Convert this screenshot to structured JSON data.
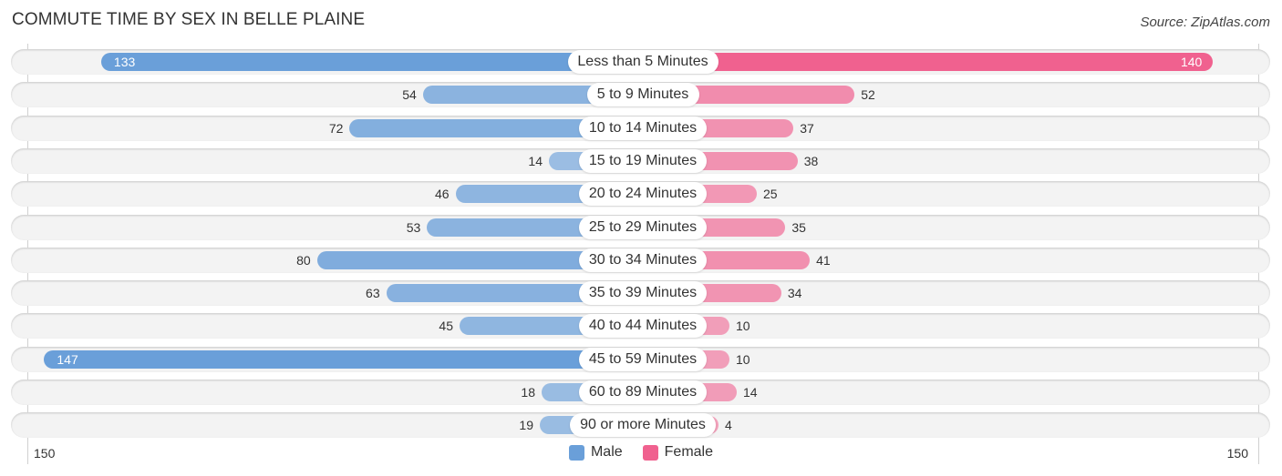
{
  "title": "COMMUTE TIME BY SEX IN BELLE PLAINE",
  "source": "Source: ZipAtlas.com",
  "colors": {
    "male": "#6a9fd9",
    "female": "#f0618f"
  },
  "chart_data": {
    "type": "bar",
    "orientation": "horizontal-diverging",
    "title": "COMMUTE TIME BY SEX IN BELLE PLAINE",
    "categories": [
      "Less than 5 Minutes",
      "5 to 9 Minutes",
      "10 to 14 Minutes",
      "15 to 19 Minutes",
      "20 to 24 Minutes",
      "25 to 29 Minutes",
      "30 to 34 Minutes",
      "35 to 39 Minutes",
      "40 to 44 Minutes",
      "45 to 59 Minutes",
      "60 to 89 Minutes",
      "90 or more Minutes"
    ],
    "series": [
      {
        "name": "Male",
        "values": [
          133,
          54,
          72,
          14,
          46,
          53,
          80,
          63,
          45,
          147,
          18,
          19
        ]
      },
      {
        "name": "Female",
        "values": [
          140,
          52,
          37,
          38,
          25,
          35,
          41,
          34,
          10,
          10,
          14,
          4
        ]
      }
    ],
    "xlim": [
      -150,
      150
    ],
    "axis_tick_labels": {
      "left": "150",
      "right": "150"
    },
    "legend": {
      "position": "bottom-center",
      "entries": [
        "Male",
        "Female"
      ]
    },
    "grid": false
  }
}
